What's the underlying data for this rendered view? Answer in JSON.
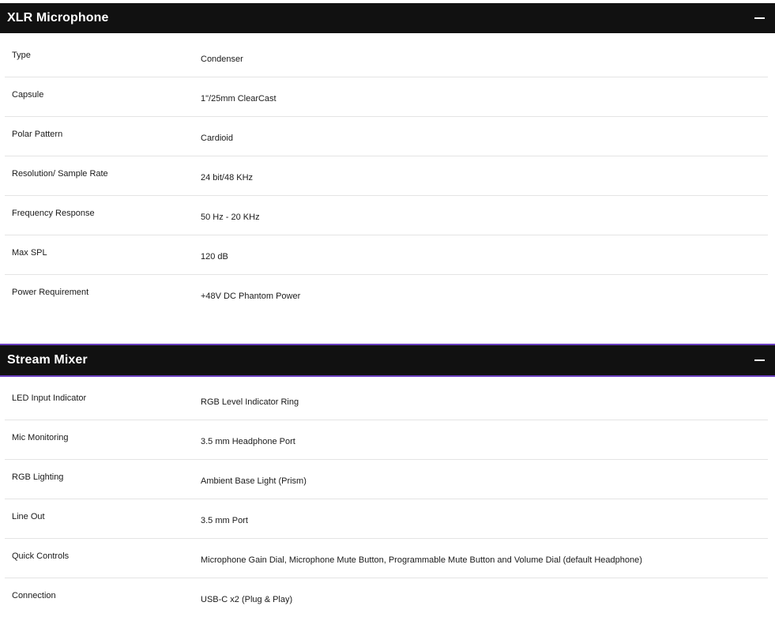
{
  "sections": [
    {
      "title": "XLR Microphone",
      "collapse_symbol": "−",
      "rows": [
        {
          "label": "Type",
          "value": "Condenser"
        },
        {
          "label": "Capsule",
          "value": "1\"/25mm ClearCast"
        },
        {
          "label": "Polar Pattern",
          "value": "Cardioid"
        },
        {
          "label": "Resolution/ Sample Rate",
          "value": "24 bit/48 KHz"
        },
        {
          "label": "Frequency Response",
          "value": "50 Hz - 20 KHz"
        },
        {
          "label": "Max SPL",
          "value": "120 dB"
        },
        {
          "label": "Power Requirement",
          "value": "+48V DC Phantom Power"
        }
      ]
    },
    {
      "title": "Stream Mixer",
      "collapse_symbol": "−",
      "rows": [
        {
          "label": "LED Input Indicator",
          "value": "RGB Level Indicator Ring"
        },
        {
          "label": "Mic Monitoring",
          "value": "3.5 mm Headphone Port"
        },
        {
          "label": "RGB Lighting",
          "value": "Ambient Base Light (Prism)"
        },
        {
          "label": "Line Out",
          "value": "3.5 mm Port"
        },
        {
          "label": "Quick Controls",
          "value": "Microphone Gain Dial, Microphone Mute Button, Programmable Mute Button and Volume Dial (default Headphone)"
        },
        {
          "label": "Connection",
          "value": "USB-C x2 (Plug & Play)"
        }
      ]
    }
  ],
  "colors": {
    "header_bg": "#111111",
    "header_text": "#ffffff",
    "accent_border": "#6a3fc0",
    "row_divider": "#e4e4e4"
  },
  "icons": {
    "collapse": "minus-icon"
  }
}
